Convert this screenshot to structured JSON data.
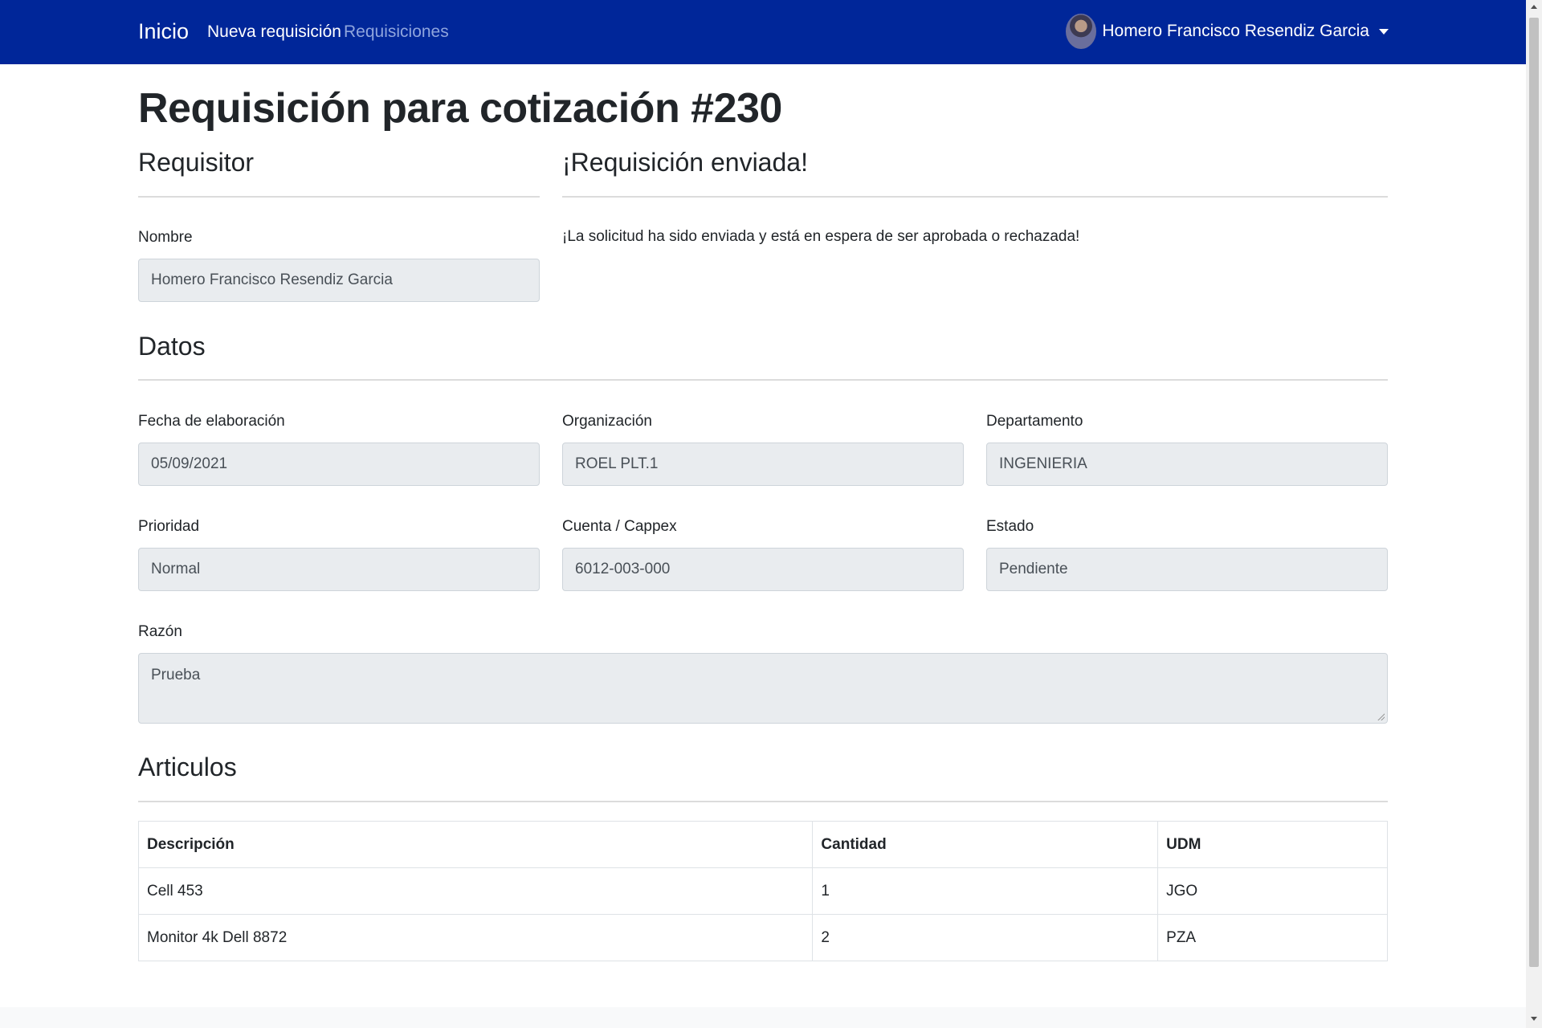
{
  "navbar": {
    "brand": "Inicio",
    "links": [
      "Nueva requisición",
      "Requisiciones"
    ],
    "user_name": "Homero Francisco Resendiz Garcia",
    "bg_color": "#002699"
  },
  "page": {
    "title": "Requisición para cotización #230"
  },
  "requisitor": {
    "title": "Requisitor",
    "name_label": "Nombre",
    "name_value": "Homero Francisco Resendiz Garcia"
  },
  "status_panel": {
    "title": "¡Requisición enviada!",
    "message": "¡La solicitud ha sido enviada y está en espera de ser aprobada o rechazada!"
  },
  "datos": {
    "title": "Datos",
    "fecha_label": "Fecha de elaboración",
    "fecha_value": "05/09/2021",
    "organizacion_label": "Organización",
    "organizacion_value": "ROEL PLT.1",
    "departamento_label": "Departamento",
    "departamento_value": "INGENIERIA",
    "prioridad_label": "Prioridad",
    "prioridad_value": "Normal",
    "cuenta_label": "Cuenta / Cappex",
    "cuenta_value": "6012-003-000",
    "estado_label": "Estado",
    "estado_value": "Pendiente",
    "razon_label": "Razón",
    "razon_value": "Prueba"
  },
  "articulos": {
    "title": "Articulos",
    "columns": [
      "Descripción",
      "Cantidad",
      "UDM"
    ],
    "rows": [
      [
        "Cell 453",
        "1",
        "JGO"
      ],
      [
        "Monitor 4k Dell 8872",
        "2",
        "PZA"
      ]
    ]
  }
}
